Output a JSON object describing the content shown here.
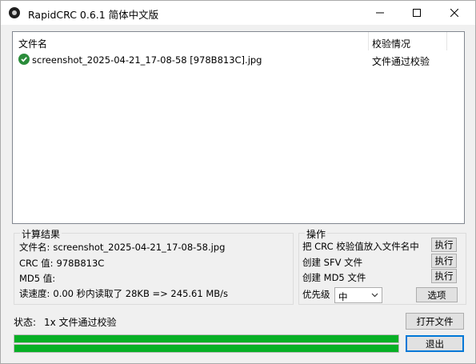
{
  "window": {
    "title": "RapidCRC 0.6.1 简体中文版"
  },
  "file_list": {
    "columns": [
      "文件名",
      "校验情况"
    ],
    "rows": [
      {
        "name": "screenshot_2025-04-21_17-08-58 [978B813C].jpg",
        "status": "文件通过校验",
        "icon": "check-circle-icon"
      }
    ]
  },
  "result": {
    "group_label": "计算结果",
    "file_label": "文件名:",
    "file_value": "screenshot_2025-04-21_17-08-58.jpg",
    "crc_label": "CRC 值:",
    "crc_value": "978B813C",
    "md5_label": "MD5 值:",
    "md5_value": "",
    "speed_label": "读速度:",
    "speed_value": "0.00 秒内读取了 28KB => 245.61 MB/s"
  },
  "ops": {
    "group_label": "操作",
    "items": [
      {
        "label": "把 CRC 校验值放入文件名中",
        "button": "执行"
      },
      {
        "label": "创建 SFV 文件",
        "button": "执行"
      },
      {
        "label": "创建 MD5 文件",
        "button": "执行"
      }
    ],
    "priority_label": "优先级",
    "priority_value": "中",
    "options_button": "选项"
  },
  "status": {
    "label": "状态:",
    "value": "1x 文件通过校验"
  },
  "buttons": {
    "open_files": "打开文件",
    "exit": "退出"
  },
  "progress": {
    "file_fraction": 1.0,
    "total_fraction": 1.0,
    "color": "#06b025"
  },
  "colors": {
    "accent": "#0078d7",
    "success": "#2a8c3a"
  }
}
